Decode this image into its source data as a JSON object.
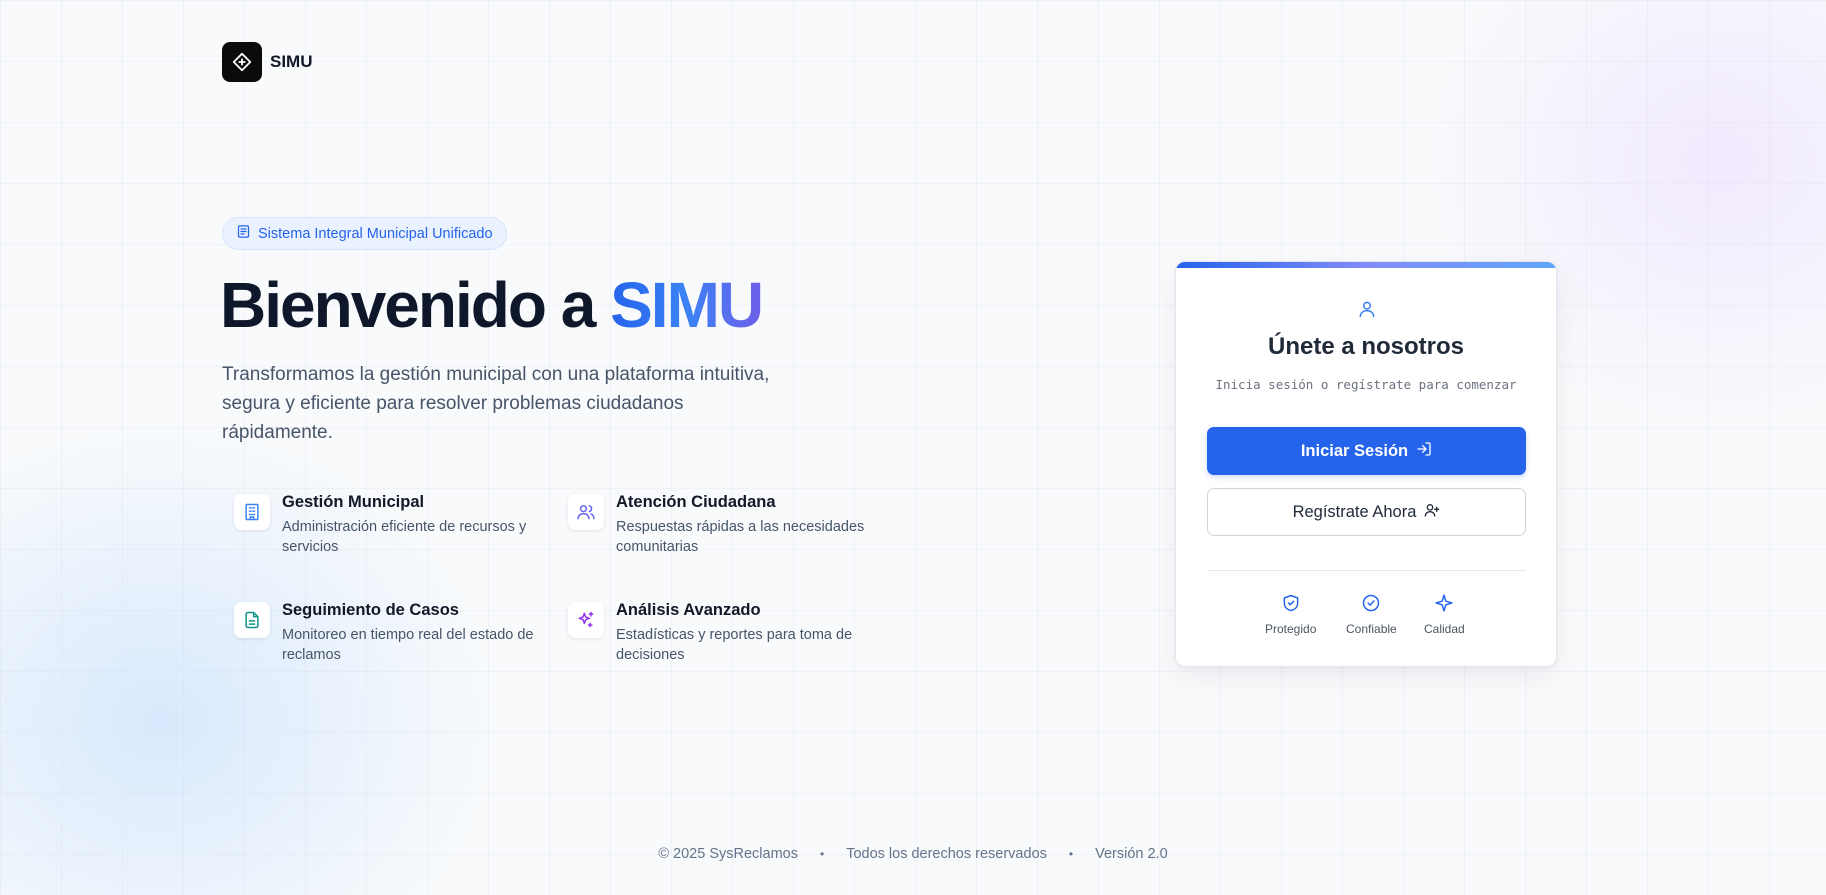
{
  "brand": {
    "name": "SIMU",
    "logo_icon": "diamond-logo-icon"
  },
  "hero": {
    "badge_icon": "document-list-icon",
    "badge": "Sistema Integral Municipal Unificado",
    "title_prefix": "Bienvenido a",
    "title_highlight": "SIMU",
    "description": "Transformamos la gestión municipal con una plataforma intuitiva, segura y eficiente para resolver problemas ciudadanos rápidamente."
  },
  "features": [
    {
      "icon": "building-icon",
      "title": "Gestión Municipal",
      "description": "Administración eficiente de recursos y servicios"
    },
    {
      "icon": "users-icon",
      "title": "Atención Ciudadana",
      "description": "Respuestas rápidas a las necesidades comunitarias"
    },
    {
      "icon": "file-text-icon",
      "title": "Seguimiento de Casos",
      "description": "Monitoreo en tiempo real del estado de reclamos"
    },
    {
      "icon": "sparkles-icon",
      "title": "Análisis Avanzado",
      "description": "Estadísticas y reportes para toma de decisiones"
    }
  ],
  "auth_card": {
    "icon": "user-icon",
    "title": "Únete a nosotros",
    "subtitle": "Inicia sesión o regístrate para comenzar",
    "login_label": "Iniciar Sesión",
    "login_icon": "log-in-icon",
    "register_label": "Regístrate Ahora",
    "register_icon": "user-plus-icon",
    "trust_items": [
      {
        "icon": "shield-check-icon",
        "label": "Protegido"
      },
      {
        "icon": "badge-check-icon",
        "label": "Confiable"
      },
      {
        "icon": "sparkle-icon",
        "label": "Calidad"
      }
    ]
  },
  "footer": {
    "copyright": "© 2025 SysReclamos",
    "rights": "Todos los derechos reservados",
    "version": "Versión 2.0",
    "separator": "•"
  },
  "colors": {
    "primary": "#2563eb",
    "title": "#0f172a",
    "muted": "#475569",
    "feature_blue": "#3b82f6",
    "feature_indigo": "#6366f1",
    "feature_teal": "#0d9488",
    "feature_purple": "#9333ea"
  }
}
